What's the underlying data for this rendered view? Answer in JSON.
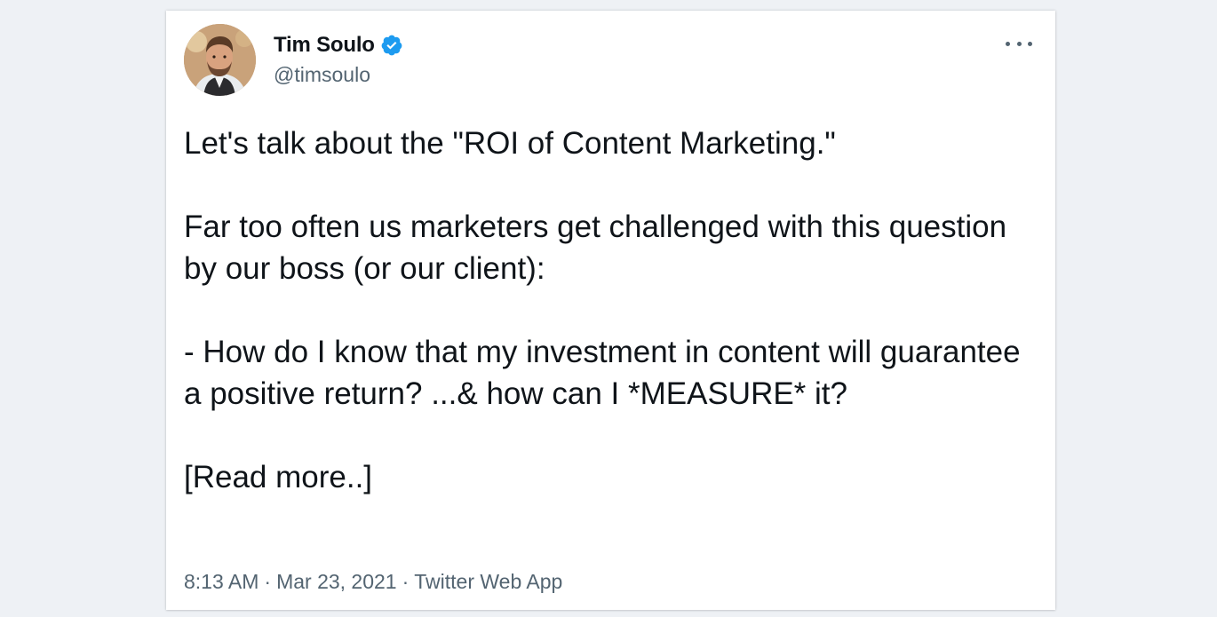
{
  "tweet": {
    "author": {
      "name": "Tim Soulo",
      "handle": "@timsoulo",
      "verified_color": "#1d9bf0"
    },
    "paragraphs": [
      "Let's talk about the \"ROI of Content Marketing.\"",
      "Far too often us marketers get challenged with this question by our boss (or our client):",
      "- How do I know that my investment in content will guarantee a positive return? ...& how can I *MEASURE* it?",
      "[Read more..]"
    ],
    "meta": {
      "time": "8:13 AM",
      "date": "Mar 23, 2021",
      "source": "Twitter Web App",
      "separator": "·"
    },
    "icons": {
      "more": "more-horizontal-icon",
      "verified": "verified-badge-icon"
    }
  }
}
